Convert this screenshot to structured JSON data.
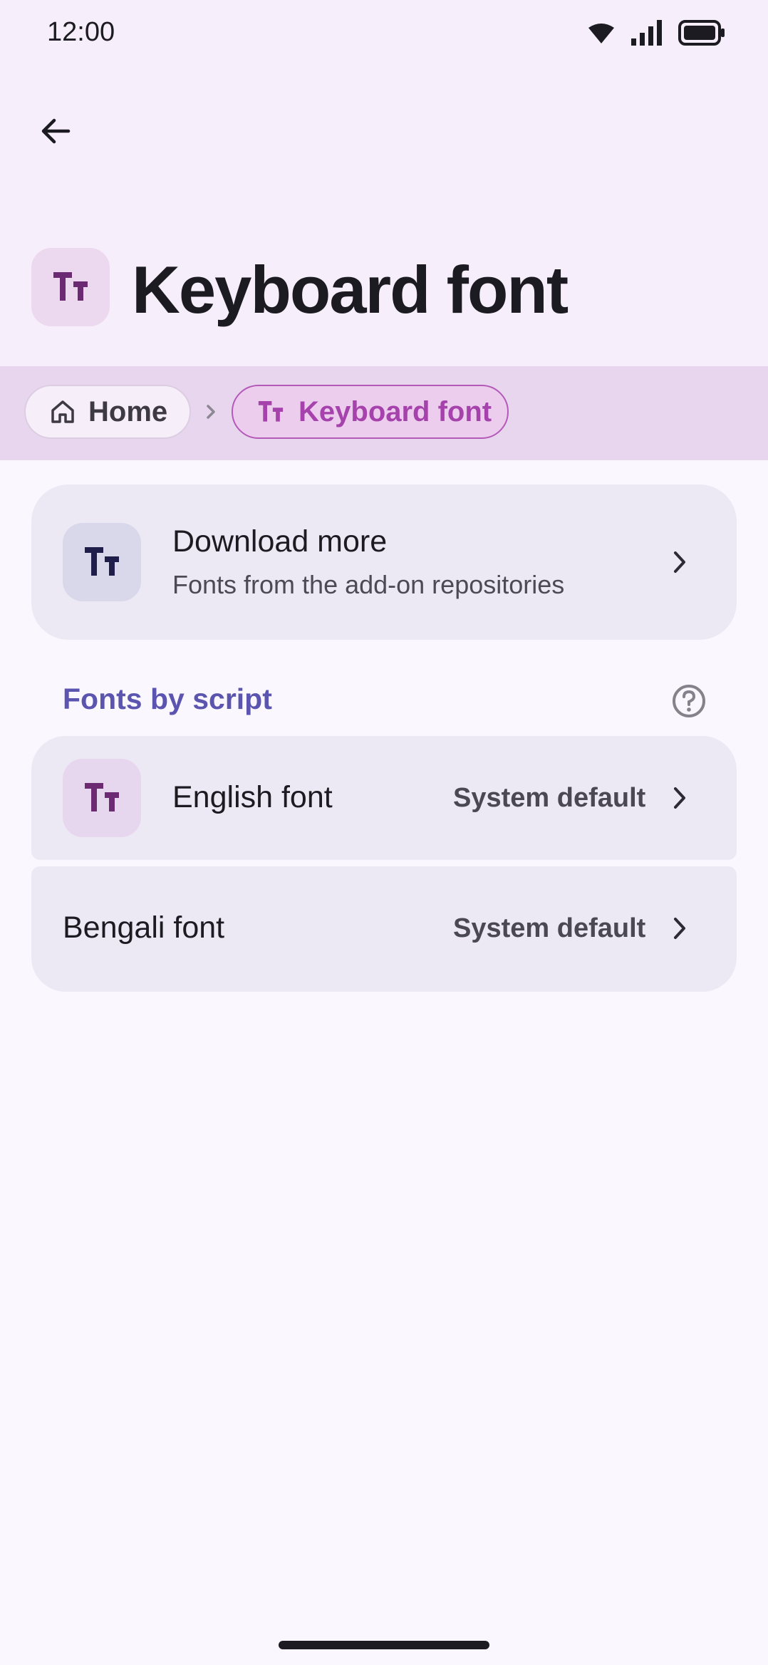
{
  "status_bar": {
    "time": "12:00",
    "icons": [
      "wifi-icon",
      "signal-icon",
      "battery-icon"
    ]
  },
  "top_bar": {
    "back_icon": "arrow-back-icon"
  },
  "page": {
    "title": "Keyboard font",
    "title_icon": "text-fields-icon"
  },
  "breadcrumb": {
    "items": [
      {
        "label": "Home",
        "icon": "home-icon"
      },
      {
        "label": "Keyboard font",
        "icon": "text-fields-icon"
      }
    ],
    "separator_icon": "chevron-right-icon"
  },
  "download": {
    "title": "Download more",
    "subtitle": "Fonts from the add-on repositories",
    "icon": "text-fields-icon"
  },
  "section": {
    "title": "Fonts by script",
    "help_icon": "help-circle-icon"
  },
  "fonts": [
    {
      "label": "English font",
      "value": "System default",
      "icon": "text-fields-icon"
    },
    {
      "label": "Bengali font",
      "value": "System default"
    }
  ],
  "colors": {
    "header_bg": "#f6eefa",
    "breadcrumb_bg": "#e8d6ee",
    "accent": "#a642ac",
    "section_title": "#5c55b0",
    "card_bg": "#ece9f5",
    "page_bg": "#faf8fe"
  }
}
